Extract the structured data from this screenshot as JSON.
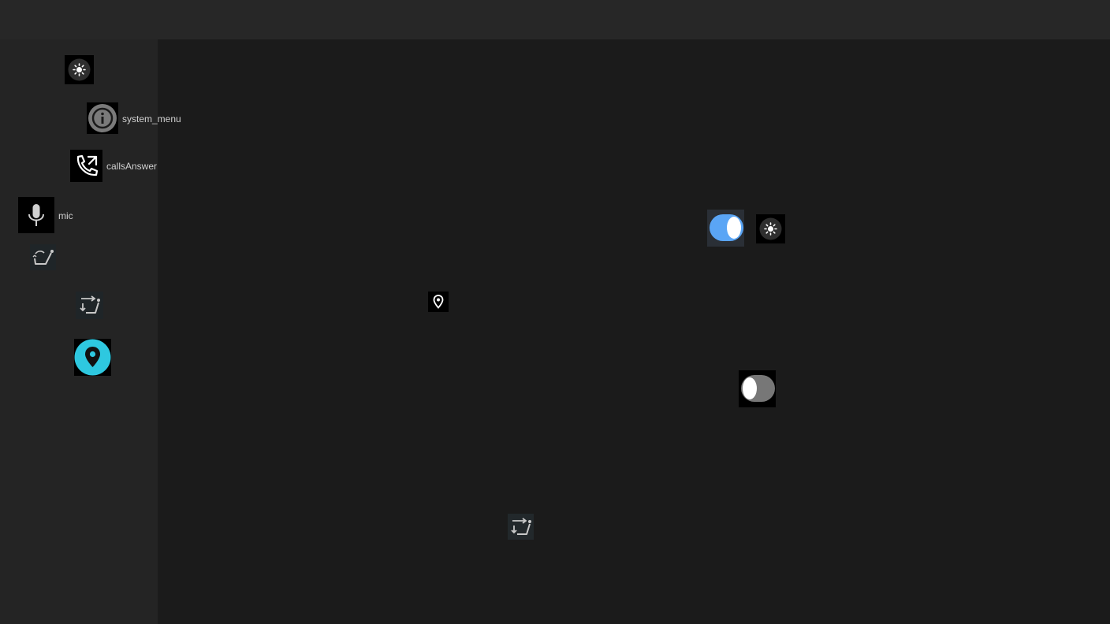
{
  "sidebar": {
    "items": [
      {
        "icon": "brightness-icon",
        "label": ""
      },
      {
        "icon": "info-icon",
        "label": "system_menu"
      },
      {
        "icon": "phone-answer-icon",
        "label": "callsAnswer"
      },
      {
        "icon": "mic-icon",
        "label": "mic"
      },
      {
        "icon": "seat-recline-icon",
        "label": ""
      },
      {
        "icon": "seat-adjust-icon",
        "label": ""
      },
      {
        "icon": "location-pin-icon",
        "label": ""
      }
    ]
  },
  "main": {
    "toggle_on": {
      "state": true,
      "color": "#5aa5f5"
    },
    "brightness_button": {
      "icon": "brightness-icon"
    },
    "location_pin": {
      "icon": "location-pin-icon"
    },
    "toggle_off": {
      "state": false,
      "color": "#777777"
    },
    "seat_adjust": {
      "icon": "seat-adjust-icon"
    }
  },
  "colors": {
    "accent_cyan": "#2ec8e0",
    "toggle_blue": "#5aa5f5"
  }
}
